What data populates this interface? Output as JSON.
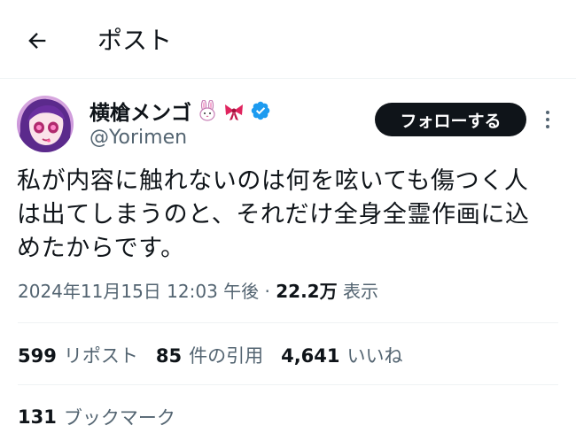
{
  "header": {
    "title": "ポスト",
    "back_icon": "arrow-left-icon"
  },
  "author": {
    "display_name": "横槍メンゴ",
    "emojis": [
      "rabbit-face",
      "ribbon"
    ],
    "verified": true,
    "handle": "@Yorimen"
  },
  "follow_button": {
    "label": "フォローする"
  },
  "more_icon": "more-vertical-icon",
  "tweet": {
    "text": "私が内容に触れないのは何を呟いても傷つく人\nは出てしまうのと、それだけ全身全霊作画に込\nめたからです。"
  },
  "meta": {
    "timestamp": "2024年11月15日 12:03 午後",
    "separator": "·",
    "views_count": "22.2万",
    "views_label": "表示"
  },
  "stats": [
    {
      "count": "599",
      "label": "リポスト"
    },
    {
      "count": "85",
      "label": "件の引用"
    },
    {
      "count": "4,641",
      "label": "いいね"
    }
  ],
  "bookmarks": {
    "count": "131",
    "label": "ブックマーク"
  },
  "colors": {
    "text_primary": "#0f1419",
    "text_secondary": "#536471",
    "divider": "#eff3f4",
    "verified_badge": "#1d9bf0",
    "follow_button_bg": "#0f1419"
  }
}
